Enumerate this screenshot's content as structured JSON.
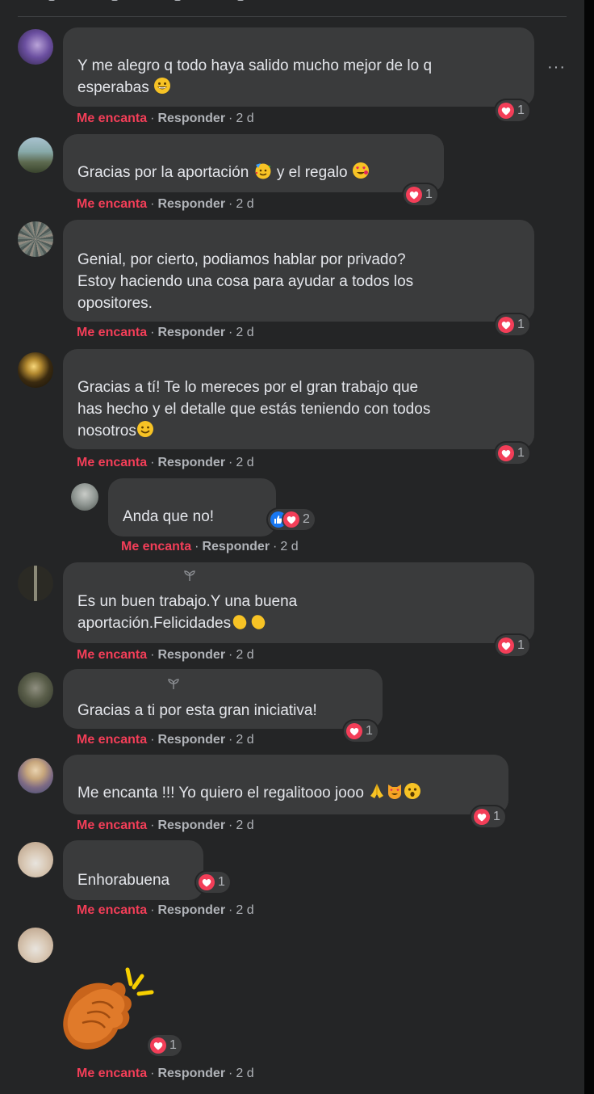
{
  "actions": {
    "love": "Me encanta",
    "reply": "Responder",
    "time": "2 d",
    "dot": "·"
  },
  "comments": [
    {
      "text": "Y me alegro q todo haya salido mucho mejor de lo q\nesperabas",
      "react_count": "1"
    },
    {
      "text": "Gracias por la aportación",
      "text2": "y el regalo",
      "react_count": "1"
    },
    {
      "text": "Genial, por cierto, podiamos hablar por privado?\nEstoy haciendo una cosa para ayudar a todos los\nopositores.",
      "react_count": "1"
    },
    {
      "text": "Gracias a tí! Te lo mereces por el gran trabajo que\nhas hecho y el detalle que estás teniendo con todos\nnosotros",
      "react_count": "1"
    },
    {
      "text": "Anda que no!",
      "react_count": "2"
    },
    {
      "text": "Es un buen trabajo.Y una buena\naportación.Felicidades",
      "react_count": "1"
    },
    {
      "text": "Gracias a ti por esta gran iniciativa!",
      "react_count": "1"
    },
    {
      "text": "Me encanta !!! Yo quiero el regalitooo jooo",
      "react_count": "1"
    },
    {
      "text": "Enhorabuena",
      "react_count": "1"
    },
    {
      "text": "",
      "react_count": "1"
    }
  ],
  "more_label": "···",
  "colors": {
    "background": "#242526",
    "bubble": "#3a3b3c",
    "love": "#f33e58",
    "like": "#1877f2"
  }
}
